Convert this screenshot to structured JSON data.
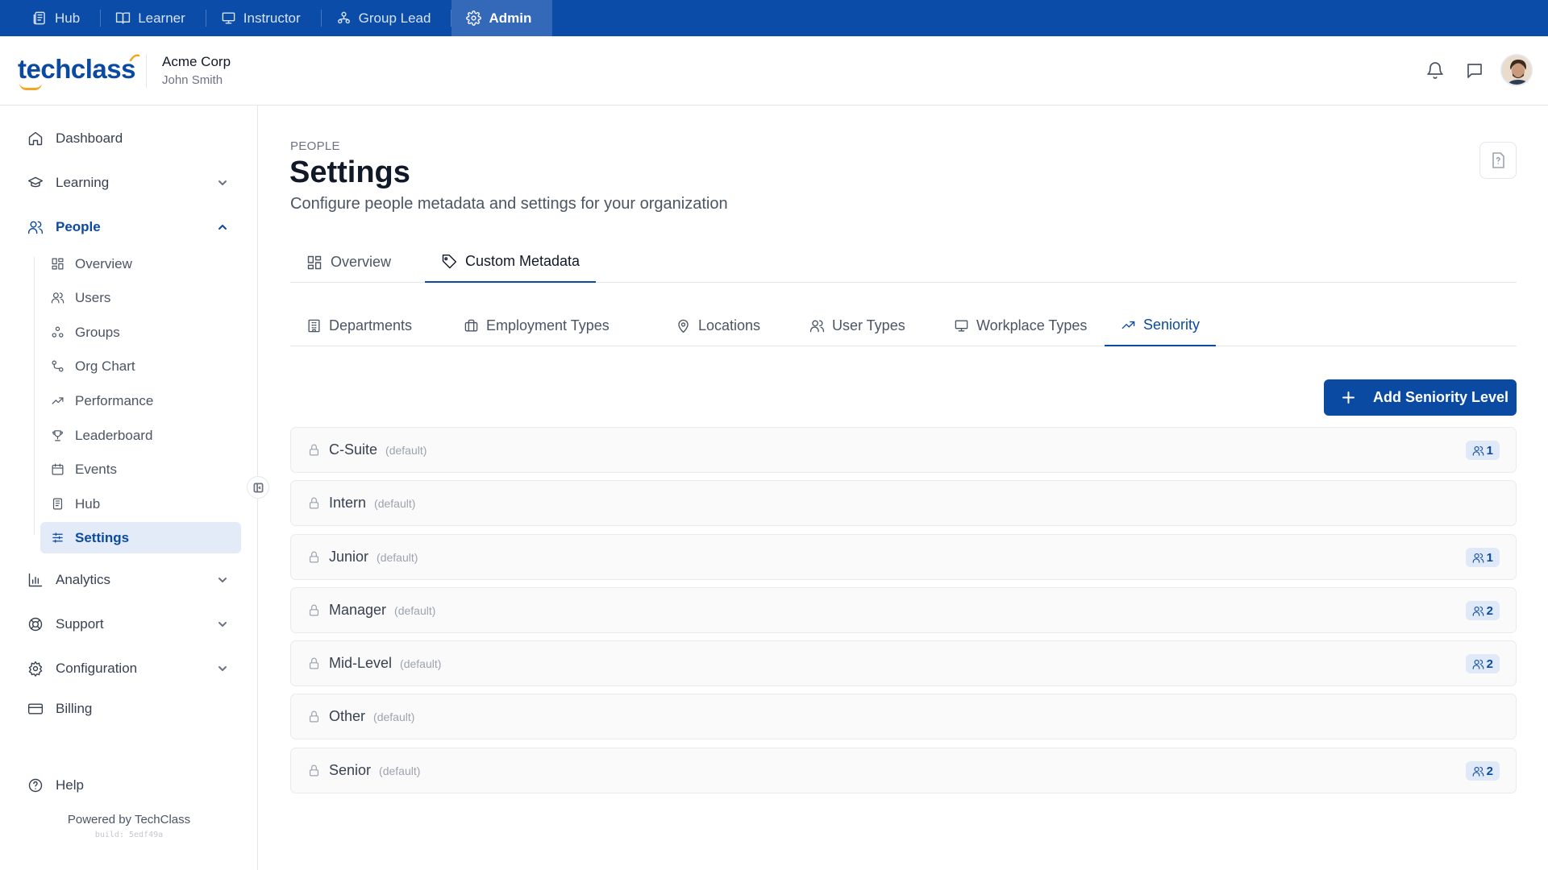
{
  "topnav": [
    {
      "label": "Hub",
      "icon": "hub-icon",
      "active": false
    },
    {
      "label": "Learner",
      "icon": "book-icon",
      "active": false
    },
    {
      "label": "Instructor",
      "icon": "presentation-icon",
      "active": false
    },
    {
      "label": "Group Lead",
      "icon": "group-lead-icon",
      "active": false
    },
    {
      "label": "Admin",
      "icon": "gear-icon",
      "active": true
    }
  ],
  "header": {
    "logo_text": "techclass",
    "org_name": "Acme Corp",
    "user_name": "John Smith"
  },
  "sidebar": {
    "items": [
      {
        "label": "Dashboard",
        "icon": "home-icon"
      },
      {
        "label": "Learning",
        "icon": "graduation-cap-icon",
        "expandable": true
      },
      {
        "label": "People",
        "icon": "users-icon",
        "expandable": true,
        "open": true
      },
      {
        "label": "Analytics",
        "icon": "bar-chart-icon",
        "expandable": true
      },
      {
        "label": "Support",
        "icon": "life-buoy-icon",
        "expandable": true
      },
      {
        "label": "Configuration",
        "icon": "gear-icon",
        "expandable": true
      },
      {
        "label": "Billing",
        "icon": "credit-card-icon"
      },
      {
        "label": "Help",
        "icon": "help-circle-icon"
      }
    ],
    "people_sub": [
      {
        "label": "Overview",
        "icon": "grid-icon"
      },
      {
        "label": "Users",
        "icon": "users-icon"
      },
      {
        "label": "Groups",
        "icon": "groups-icon"
      },
      {
        "label": "Org Chart",
        "icon": "org-chart-icon"
      },
      {
        "label": "Performance",
        "icon": "trending-up-icon"
      },
      {
        "label": "Leaderboard",
        "icon": "trophy-icon"
      },
      {
        "label": "Events",
        "icon": "calendar-icon"
      },
      {
        "label": "Hub",
        "icon": "hub-icon"
      },
      {
        "label": "Settings",
        "icon": "sliders-icon",
        "active": true
      }
    ],
    "powered_by": "Powered by TechClass",
    "build": "build: 5edf49a"
  },
  "page": {
    "eyebrow": "PEOPLE",
    "title": "Settings",
    "subtitle": "Configure people metadata and settings for your organization"
  },
  "tabs": [
    {
      "label": "Overview",
      "icon": "grid-icon",
      "active": false
    },
    {
      "label": "Custom Metadata",
      "icon": "tag-icon",
      "active": true
    }
  ],
  "subtabs": [
    {
      "label": "Departments",
      "icon": "building-icon",
      "active": false
    },
    {
      "label": "Employment Types",
      "icon": "briefcase-icon",
      "active": false
    },
    {
      "label": "Locations",
      "icon": "map-pin-icon",
      "active": false
    },
    {
      "label": "User Types",
      "icon": "users-icon",
      "active": false
    },
    {
      "label": "Workplace Types",
      "icon": "monitor-icon",
      "active": false
    },
    {
      "label": "Seniority",
      "icon": "trending-up-icon",
      "active": true
    }
  ],
  "add_button_label": "Add Seniority Level",
  "seniority_levels": [
    {
      "name": "C-Suite",
      "tag": "(default)",
      "count": "1"
    },
    {
      "name": "Intern",
      "tag": "(default)",
      "count": null
    },
    {
      "name": "Junior",
      "tag": "(default)",
      "count": "1"
    },
    {
      "name": "Manager",
      "tag": "(default)",
      "count": "2"
    },
    {
      "name": "Mid-Level",
      "tag": "(default)",
      "count": "2"
    },
    {
      "name": "Other",
      "tag": "(default)",
      "count": null
    },
    {
      "name": "Senior",
      "tag": "(default)",
      "count": "2"
    }
  ],
  "colors": {
    "brand": "#0b4aa2",
    "topbar": "#0a4ca8",
    "accent_orange": "#f5a524",
    "active_bg": "#e3ebf8"
  }
}
